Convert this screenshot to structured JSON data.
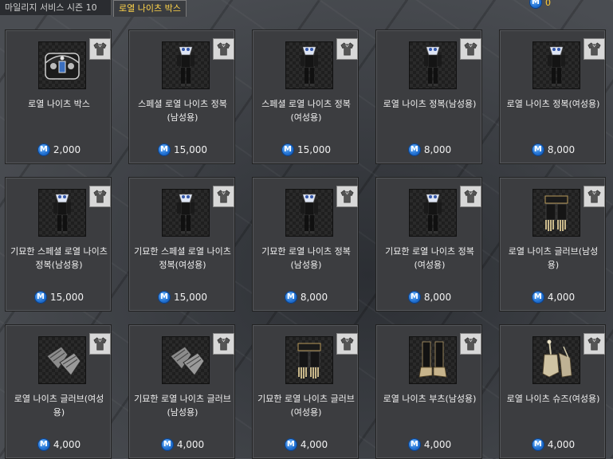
{
  "tabs": [
    {
      "label": "마일리지 서비스 시즌 10",
      "active": false
    },
    {
      "label": "로열 나이츠 박스",
      "active": true
    }
  ],
  "balance": {
    "value": "0",
    "currency_icon": "maple-point-icon"
  },
  "colors": {
    "active_tab": "#ffd44a",
    "currency": "#1f6fd0",
    "card_bg": "#3c3d40"
  },
  "items": [
    {
      "name": "로열 나이츠 박스",
      "price": "2,000",
      "icon": "treasure-box-icon"
    },
    {
      "name": "스페셜 로열 나이츠 정복(남성용)",
      "price": "15,000",
      "icon": "knight-uniform-icon"
    },
    {
      "name": "스페셜 로열 나이츠 정복(여성용)",
      "price": "15,000",
      "icon": "knight-uniform-icon"
    },
    {
      "name": "로열 나이츠 정복(남성용)",
      "price": "8,000",
      "icon": "knight-uniform-icon"
    },
    {
      "name": "로열 나이츠 정복(여성용)",
      "price": "8,000",
      "icon": "knight-uniform-icon"
    },
    {
      "name": "기묘한 스페셜 로열 나이츠 정복(남성용)",
      "price": "15,000",
      "icon": "knight-uniform-icon"
    },
    {
      "name": "기묘한 스페셜 로열 나이츠 정복(여성용)",
      "price": "15,000",
      "icon": "knight-uniform-icon"
    },
    {
      "name": "기묘한 로열 나이츠 정복(남성용)",
      "price": "8,000",
      "icon": "knight-uniform-icon"
    },
    {
      "name": "기묘한 로열 나이츠 정복(여성용)",
      "price": "8,000",
      "icon": "knight-uniform-icon"
    },
    {
      "name": "로열 나이츠 글러브(남성용)",
      "price": "4,000",
      "icon": "dark-glove-icon"
    },
    {
      "name": "로열 나이츠 글러브(여성용)",
      "price": "4,000",
      "icon": "silver-glove-icon"
    },
    {
      "name": "기묘한 로열 나이츠 글러브(남성용)",
      "price": "4,000",
      "icon": "silver-glove-icon"
    },
    {
      "name": "기묘한 로열 나이츠 글러브(여성용)",
      "price": "4,000",
      "icon": "dark-glove-icon"
    },
    {
      "name": "로열 나이츠 부츠(남성용)",
      "price": "4,000",
      "icon": "boots-icon"
    },
    {
      "name": "로열 나이츠 슈즈(여성용)",
      "price": "4,000",
      "icon": "heels-icon"
    }
  ]
}
